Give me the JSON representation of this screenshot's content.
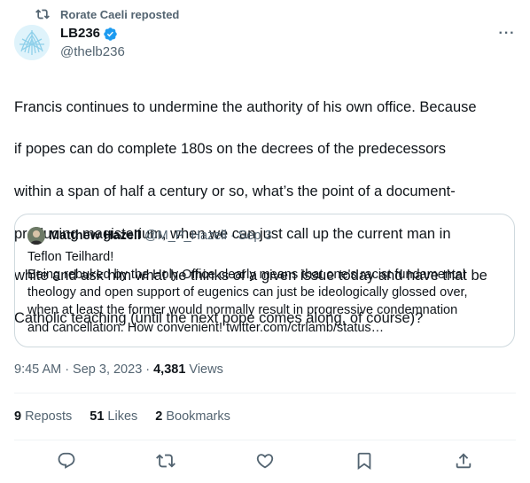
{
  "social_context": {
    "text": "Rorate Caeli reposted"
  },
  "author": {
    "display_name": "LB236",
    "handle": "@thelb236"
  },
  "more_label": "···",
  "tweet": {
    "text_lines": [
      "Francis continues to undermine the authority of his own office. Because",
      "if popes can do complete 180s on the decrees of the predecessors",
      "within a span of half a century or so, what’s the point of a document-",
      "producing magisterium, when we can just call up the current man in",
      "white and ask him what he thinks of a given issue today and have that be",
      "Catholic teaching (until the next pope comes along, of course)?"
    ]
  },
  "quote": {
    "name": "Matthew Hazell",
    "handle": "@M_P_Hazell",
    "dot": "·",
    "date": "Sep 3",
    "lines": [
      "Teflon Teilhard!",
      "Being rebuked by the Holy Office clearly means that one's racist fundamental",
      "theology and open support of eugenics can just be ideologically glossed over,",
      "when at least the former would normally result in progressive condemnation",
      "and cancellation. How convenient! twitter.com/ctrlamb/status…"
    ]
  },
  "meta": {
    "time": "9:45 AM",
    "dot1": "·",
    "date": "Sep 3, 2023",
    "dot2": "·",
    "views_count": "4,381",
    "views_label": "Views"
  },
  "stats": {
    "reposts_count": "9",
    "reposts_label": "Reposts",
    "likes_count": "51",
    "likes_label": "Likes",
    "bookmarks_count": "2",
    "bookmarks_label": "Bookmarks"
  },
  "icons": {
    "repost": "repost-icon",
    "verified": "verified-badge-icon",
    "reply": "reply-icon",
    "like": "heart-icon",
    "bookmark": "bookmark-icon",
    "share": "share-icon"
  },
  "colors": {
    "text": "#0f1419",
    "secondary": "#536471",
    "verified": "#1d9bf0",
    "border": "#cfd9de"
  }
}
